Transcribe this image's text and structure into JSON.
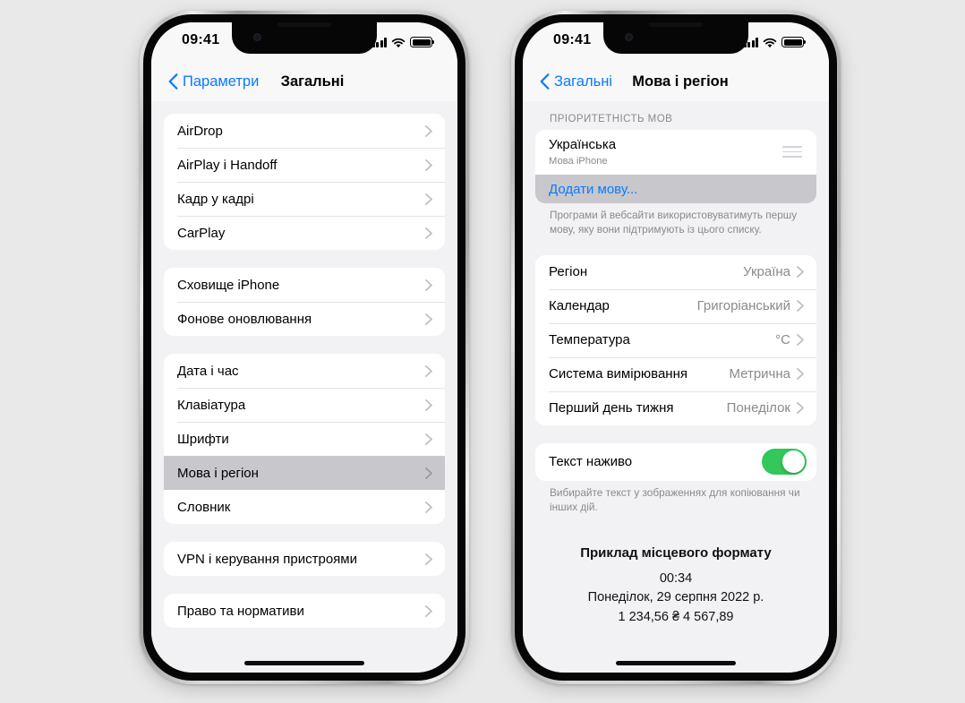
{
  "accent": "#0a7aff",
  "toggle_on_color": "#34c759",
  "selected_row_color": "#c7c7cc",
  "page_background": "#e9e9e9",
  "phones": {
    "left": {
      "status": {
        "time": "09:41",
        "signal_icon": "cellular-bars-icon",
        "wifi_icon": "wifi-icon",
        "battery_icon": "battery-full-icon"
      },
      "nav": {
        "back_label": "Параметри",
        "title": "Загальні"
      },
      "groups": [
        {
          "rows": [
            {
              "label": "AirDrop",
              "selected": false
            },
            {
              "label": "AirPlay і Handoff",
              "selected": false
            },
            {
              "label": "Кадр у кадрі",
              "selected": false
            },
            {
              "label": "CarPlay",
              "selected": false
            }
          ]
        },
        {
          "rows": [
            {
              "label": "Сховище iPhone",
              "selected": false
            },
            {
              "label": "Фонове оновлювання",
              "selected": false
            }
          ]
        },
        {
          "rows": [
            {
              "label": "Дата і час",
              "selected": false
            },
            {
              "label": "Клавіатура",
              "selected": false
            },
            {
              "label": "Шрифти",
              "selected": false
            },
            {
              "label": "Мова і регіон",
              "selected": true
            },
            {
              "label": "Словник",
              "selected": false
            }
          ]
        },
        {
          "rows": [
            {
              "label": "VPN і керування пристроями",
              "selected": false
            }
          ]
        },
        {
          "rows": [
            {
              "label": "Право та нормативи",
              "selected": false
            }
          ]
        }
      ]
    },
    "right": {
      "status": {
        "time": "09:41",
        "signal_icon": "cellular-bars-icon",
        "wifi_icon": "wifi-icon",
        "battery_icon": "battery-full-icon"
      },
      "nav": {
        "back_label": "Загальні",
        "title": "Мова і регіон"
      },
      "language_section": {
        "header": "ПРІОРИТЕТНІСТЬ МОВ",
        "language_name": "Українська",
        "language_sub": "Мова iPhone",
        "reorder_icon": "drag-handle-icon",
        "add_language_label": "Додати мову...",
        "footnote": "Програми й вебсайти використовуватимуть першу мову, яку вони підтримують із цього списку."
      },
      "region_rows": [
        {
          "label": "Регіон",
          "value": "Україна"
        },
        {
          "label": "Календар",
          "value": "Григоріанський"
        },
        {
          "label": "Температура",
          "value": "°C"
        },
        {
          "label": "Система вимірювання",
          "value": "Метрична"
        },
        {
          "label": "Перший день тижня",
          "value": "Понеділок"
        }
      ],
      "live_text": {
        "label": "Текст наживо",
        "enabled": true,
        "footnote": "Вибирайте текст у зображеннях для копіювання чи інших дій."
      },
      "format_sample": {
        "title": "Приклад місцевого формату",
        "time": "00:34",
        "date": "Понеділок, 29 серпня 2022 р.",
        "numbers": "1 234,56 ₴   4 567,89"
      }
    }
  }
}
